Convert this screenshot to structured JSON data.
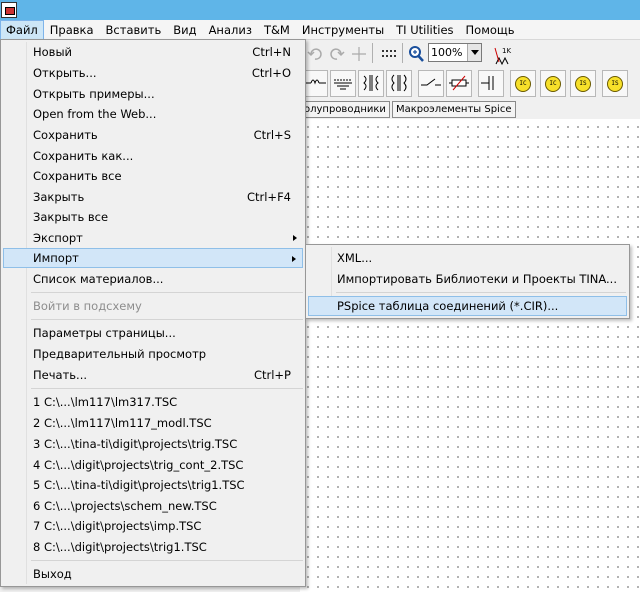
{
  "menubar": {
    "items": [
      "Файл",
      "Правка",
      "Вставить",
      "Вид",
      "Анализ",
      "T&M",
      "Инструменты",
      "TI Utilities",
      "Помощь"
    ]
  },
  "toolbar": {
    "zoom": "100%"
  },
  "component_tabs": [
    "олупроводники",
    "Макроэлементы Spice"
  ],
  "file_menu": {
    "new": {
      "label": "Новый",
      "shortcut": "Ctrl+N"
    },
    "open": {
      "label": "Открыть...",
      "shortcut": "Ctrl+O"
    },
    "open_examples": {
      "label": "Открыть примеры..."
    },
    "open_web": {
      "label": "Open from the Web..."
    },
    "save": {
      "label": "Сохранить",
      "shortcut": "Ctrl+S"
    },
    "save_as": {
      "label": "Сохранить как..."
    },
    "save_all": {
      "label": "Сохранить все"
    },
    "close": {
      "label": "Закрыть",
      "shortcut": "Ctrl+F4"
    },
    "close_all": {
      "label": "Закрыть все"
    },
    "export": {
      "label": "Экспорт"
    },
    "import": {
      "label": "Импорт"
    },
    "bom": {
      "label": "Список материалов..."
    },
    "enter_subcircuit": {
      "label": "Войти в подсхему"
    },
    "page_setup": {
      "label": "Параметры страницы..."
    },
    "print_preview": {
      "label": "Предварительный просмотр"
    },
    "print": {
      "label": "Печать...",
      "shortcut": "Ctrl+P"
    },
    "recent": [
      "1  C:\\...\\lm117\\lm317.TSC",
      "2  C:\\...\\lm117\\lm117_modl.TSC",
      "3  C:\\...\\tina-ti\\digit\\projects\\trig.TSC",
      "4  C:\\...\\digit\\projects\\trig_cont_2.TSC",
      "5  C:\\...\\tina-ti\\digit\\projects\\trig1.TSC",
      "6  C:\\...\\projects\\schem_new.TSC",
      "7  C:\\...\\digit\\projects\\imp.TSC",
      "8  C:\\...\\digit\\projects\\trig1.TSC"
    ],
    "exit": {
      "label": "Выход"
    }
  },
  "import_submenu": {
    "xml": "XML...",
    "tina_libs": "Импортировать Библиотеки и Проекты TINA...",
    "pspice": "PSpice таблица соединений (*.CIR)..."
  }
}
